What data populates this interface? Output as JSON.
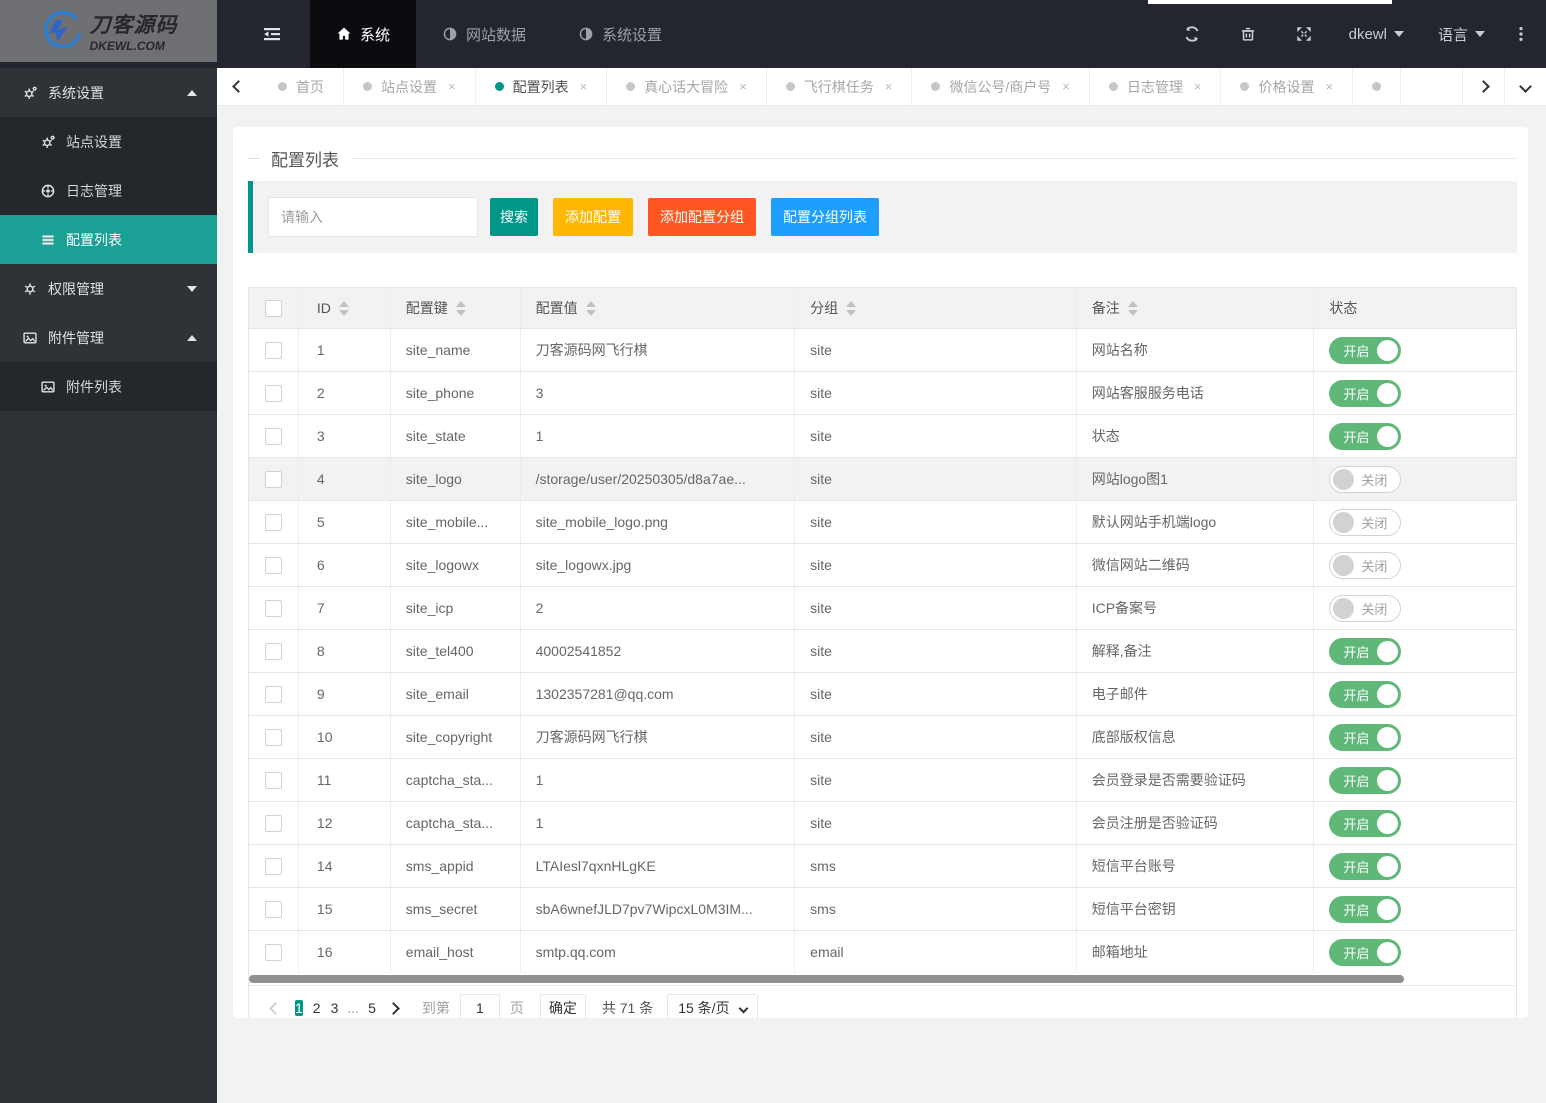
{
  "topbar": {
    "logo": {
      "line1": "刀客源码",
      "line2": "DKEWL.COM"
    },
    "toggle_icon": "shrink-menu-icon",
    "nav": [
      {
        "label": "系统",
        "icon": "home-icon",
        "active": true
      },
      {
        "label": "网站数据",
        "icon": "half-circle-icon",
        "active": false
      },
      {
        "label": "系统设置",
        "icon": "half-circle-icon",
        "active": false
      }
    ],
    "action_icons": [
      "refresh-icon",
      "trash-icon",
      "fullscreen-icon"
    ],
    "user": "dkewl",
    "language": "语言",
    "more_icon": "more-vertical-icon"
  },
  "tabbar": {
    "tabs": [
      {
        "label": "首页",
        "closable": false,
        "active": false
      },
      {
        "label": "站点设置",
        "closable": true,
        "active": false
      },
      {
        "label": "配置列表",
        "closable": true,
        "active": true
      },
      {
        "label": "真心话大冒险",
        "closable": true,
        "active": false
      },
      {
        "label": "飞行棋任务",
        "closable": true,
        "active": false
      },
      {
        "label": "微信公号/商户号",
        "closable": true,
        "active": false
      },
      {
        "label": "日志管理",
        "closable": true,
        "active": false
      },
      {
        "label": "价格设置",
        "closable": true,
        "active": false
      },
      {
        "label": "",
        "closable": false,
        "active": false
      }
    ]
  },
  "sidebar": {
    "groups": [
      {
        "label": "系统设置",
        "icon": "gears-icon",
        "expanded": true,
        "items": [
          {
            "label": "站点设置",
            "icon": "gears-icon",
            "active": false
          },
          {
            "label": "日志管理",
            "icon": "log-icon",
            "active": false
          },
          {
            "label": "配置列表",
            "icon": "list-icon",
            "active": true
          }
        ]
      },
      {
        "label": "权限管理",
        "icon": "gear-icon",
        "expanded": false,
        "items": []
      },
      {
        "label": "附件管理",
        "icon": "image-icon",
        "expanded": true,
        "items": [
          {
            "label": "附件列表",
            "icon": "image-icon",
            "active": false
          }
        ]
      }
    ]
  },
  "main": {
    "panel_title": "配置列表",
    "search": {
      "placeholder": "请输入",
      "buttons": [
        {
          "label": "搜索",
          "color": "#009688"
        },
        {
          "label": "添加配置",
          "color": "#FFB800"
        },
        {
          "label": "添加配置分组",
          "color": "#FF5722"
        },
        {
          "label": "配置分组列表",
          "color": "#1E9FFF"
        }
      ]
    },
    "table": {
      "columns": [
        {
          "label": "ID",
          "sortable": true
        },
        {
          "label": "配置键",
          "sortable": true
        },
        {
          "label": "配置值",
          "sortable": true
        },
        {
          "label": "分组",
          "sortable": true
        },
        {
          "label": "备注",
          "sortable": true
        },
        {
          "label": "状态",
          "sortable": false
        }
      ],
      "toggle_on_label": "开启",
      "toggle_off_label": "关闭",
      "rows": [
        {
          "id": "1",
          "key": "site_name",
          "value": "刀客源码网飞行棋",
          "group": "site",
          "note": "网站名称",
          "status": "on",
          "highlight": false
        },
        {
          "id": "2",
          "key": "site_phone",
          "value": "3",
          "group": "site",
          "note": "网站客服服务电话",
          "status": "on",
          "highlight": false
        },
        {
          "id": "3",
          "key": "site_state",
          "value": "1",
          "group": "site",
          "note": "状态",
          "status": "on",
          "highlight": false
        },
        {
          "id": "4",
          "key": "site_logo",
          "value": "/storage/user/20250305/d8a7ae...",
          "group": "site",
          "note": "网站logo图1",
          "status": "off",
          "highlight": true
        },
        {
          "id": "5",
          "key": "site_mobile...",
          "value": "site_mobile_logo.png",
          "group": "site",
          "note": "默认网站手机端logo",
          "status": "off",
          "highlight": false
        },
        {
          "id": "6",
          "key": "site_logowx",
          "value": "site_logowx.jpg",
          "group": "site",
          "note": "微信网站二维码",
          "status": "off",
          "highlight": false
        },
        {
          "id": "7",
          "key": "site_icp",
          "value": "2",
          "group": "site",
          "note": "ICP备案号",
          "status": "off",
          "highlight": false
        },
        {
          "id": "8",
          "key": "site_tel400",
          "value": "40002541852",
          "group": "site",
          "note": "解释,备注",
          "status": "on",
          "highlight": false
        },
        {
          "id": "9",
          "key": "site_email",
          "value": "1302357281@qq.com",
          "group": "site",
          "note": "电子邮件",
          "status": "on",
          "highlight": false
        },
        {
          "id": "10",
          "key": "site_copyright",
          "value": "刀客源码网飞行棋",
          "group": "site",
          "note": "底部版权信息",
          "status": "on",
          "highlight": false
        },
        {
          "id": "11",
          "key": "captcha_sta...",
          "value": "1",
          "group": "site",
          "note": "会员登录是否需要验证码",
          "status": "on",
          "highlight": false
        },
        {
          "id": "12",
          "key": "captcha_sta...",
          "value": "1",
          "group": "site",
          "note": "会员注册是否验证码",
          "status": "on",
          "highlight": false
        },
        {
          "id": "14",
          "key": "sms_appid",
          "value": "LTAIesl7qxnHLgKE",
          "group": "sms",
          "note": "短信平台账号",
          "status": "on",
          "highlight": false
        },
        {
          "id": "15",
          "key": "sms_secret",
          "value": "sbA6wnefJLD7pv7WipcxL0M3IM...",
          "group": "sms",
          "note": "短信平台密钥",
          "status": "on",
          "highlight": false
        },
        {
          "id": "16",
          "key": "email_host",
          "value": "smtp.qq.com",
          "group": "email",
          "note": "邮箱地址",
          "status": "on",
          "highlight": false
        }
      ]
    },
    "pagination": {
      "pages": [
        "1",
        "2",
        "3",
        "...",
        "5"
      ],
      "active_page": "1",
      "goto_label": "到第",
      "goto_value": "1",
      "page_unit": "页",
      "confirm_label": "确定",
      "total_label": "共 71 条",
      "page_size": "15 条/页"
    }
  },
  "colors": {
    "accent": "#009688",
    "sidebar_active": "#1aa094",
    "toggle_on": "#5FB878",
    "warning": "#FFB800",
    "danger": "#FF5722",
    "info": "#1E9FFF"
  }
}
